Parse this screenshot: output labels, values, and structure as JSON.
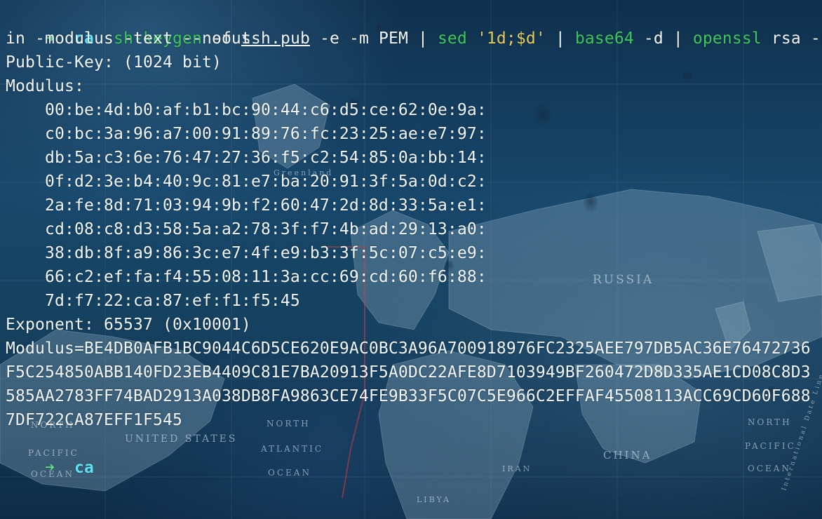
{
  "background": {
    "map_labels": [
      "RUSSIA",
      "CHINA",
      "UNITED STATES",
      "NORTH",
      "PACIFIC",
      "OCEAN",
      "NORTH",
      "ATLANTIC",
      "OCEAN",
      "NORTH",
      "PACIFIC",
      "OCEAN",
      "IRAN",
      "LIBYA",
      "Greenland",
      "International Date Line"
    ]
  },
  "prompt": {
    "arrow": "➜",
    "directory": "ca"
  },
  "command": {
    "part1": "ssh-keygen",
    "part2": " -f ",
    "file": "ssh.pub",
    "part3": " -e -m PEM | ",
    "sed": "sed",
    "part4": " ",
    "sed_arg": "'1d;$d'",
    "part5": " | ",
    "base64": "base64",
    "part6": " -d | ",
    "openssl": "openssl",
    "part7": " rsa -pub",
    "wrap": "in -modulus -text --noout"
  },
  "output": {
    "public_key": "Public-Key: (1024 bit)",
    "modulus_label": "Modulus:",
    "modulus_lines": [
      "00:be:4d:b0:af:b1:bc:90:44:c6:d5:ce:62:0e:9a:",
      "c0:bc:3a:96:a7:00:91:89:76:fc:23:25:ae:e7:97:",
      "db:5a:c3:6e:76:47:27:36:f5:c2:54:85:0a:bb:14:",
      "0f:d2:3e:b4:40:9c:81:e7:ba:20:91:3f:5a:0d:c2:",
      "2a:fe:8d:71:03:94:9b:f2:60:47:2d:8d:33:5a:e1:",
      "cd:08:c8:d3:58:5a:a2:78:3f:f7:4b:ad:29:13:a0:",
      "38:db:8f:a9:86:3c:e7:4f:e9:b3:3f:5c:07:c5:e9:",
      "66:c2:ef:fa:f4:55:08:11:3a:cc:69:cd:60:f6:88:",
      "7d:f7:22:ca:87:ef:f1:f5:45"
    ],
    "exponent": "Exponent: 65537 (0x10001)",
    "modulus_hex_lines": [
      "Modulus=BE4DB0AFB1BC9044C6D5CE620E9AC0BC3A96A700918976FC2325AEE797DB5AC36E76472736",
      "F5C254850ABB140FD23EB4409C81E7BA20913F5A0DC22AFE8D7103949BF260472D8D335AE1CD08C8D3",
      "585AA2783FF74BAD2913A038DB8FA9863CE74FE9B33F5C07C5E966C2EFFAF45508113ACC69CD60F688",
      "7DF722CA87EFF1F545"
    ]
  },
  "final_prompt": {
    "arrow": "➜",
    "directory": "ca"
  }
}
